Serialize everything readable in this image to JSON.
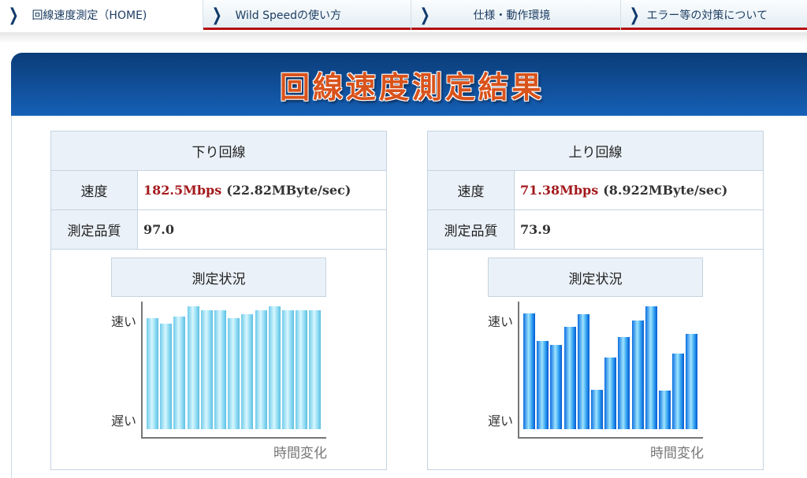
{
  "nav": [
    {
      "label": "回線速度測定（HOME)"
    },
    {
      "label": "Wild Speedの使い方"
    },
    {
      "label": "仕様・動作環境"
    },
    {
      "label": "エラー等の対策について"
    }
  ],
  "banner_title": "回線速度測定結果",
  "panels": [
    {
      "title": "下り回線",
      "speed_label": "速度",
      "speed": "182.5Mbps",
      "speed_bytes": "(22.82MByte/sec)",
      "quality_label": "測定品質",
      "quality": "97.0",
      "status_label": "測定状況"
    },
    {
      "title": "上り回線",
      "speed_label": "速度",
      "speed": "71.38Mbps",
      "speed_bytes": "(8.922MByte/sec)",
      "quality_label": "測定品質",
      "quality": "73.9",
      "status_label": "測定状況"
    }
  ],
  "chart_data": [
    {
      "type": "bar",
      "title": "測定状況",
      "ylabel_top": "速い",
      "ylabel_bottom": "遅い",
      "xlabel": "時間変化",
      "ylim": [
        0,
        100
      ],
      "values": [
        87,
        83,
        88,
        96,
        93,
        93,
        87,
        90,
        93,
        96,
        93,
        93,
        93
      ]
    },
    {
      "type": "bar",
      "title": "測定状況",
      "ylabel_top": "速い",
      "ylabel_bottom": "遅い",
      "xlabel": "時間変化",
      "ylim": [
        0,
        100
      ],
      "values": [
        91,
        69,
        66,
        80,
        90,
        31,
        56,
        72,
        85,
        96,
        30,
        59,
        75
      ]
    }
  ],
  "colors": {
    "accent_red": "#a3191c",
    "nav_border": "#b50d12",
    "banner": "#1560b6"
  }
}
